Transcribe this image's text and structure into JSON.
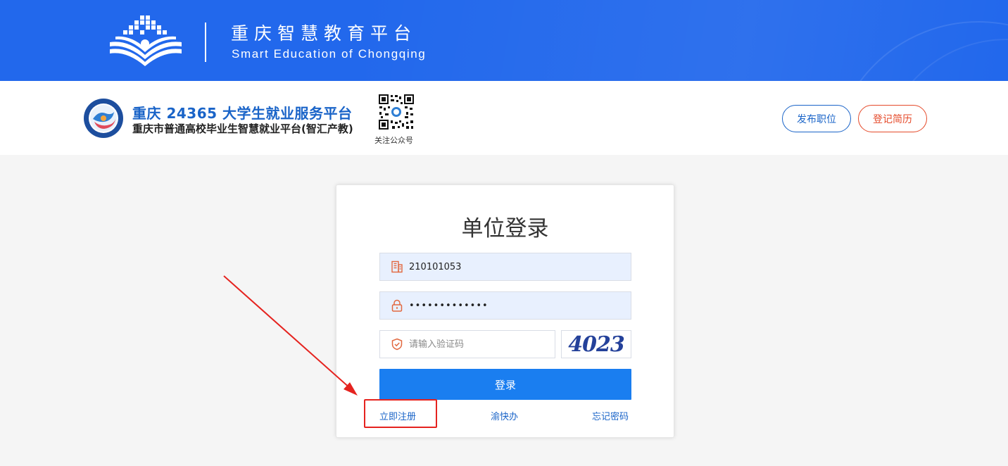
{
  "banner": {
    "title": "重庆智慧教育平台",
    "subtitle": "Smart Education of Chongqing"
  },
  "header": {
    "site_title": "重庆 24365 大学生就业服务平台",
    "site_subtitle": "重庆市普通高校毕业生智慧就业平台(智汇产教)",
    "qr_caption": "关注公众号",
    "buttons": {
      "post_job": "发布职位",
      "register_resume": "登记简历"
    }
  },
  "login": {
    "title": "单位登录",
    "account_value": "210101053",
    "password_mask": "•••••••••••••",
    "captcha_placeholder": "请输入验证码",
    "captcha_text": "4023",
    "submit_label": "登录",
    "links": {
      "register": "立即注册",
      "yukuaiban": "渝快办",
      "forgot": "忘记密码"
    }
  },
  "colors": {
    "banner_blue": "#2268ec",
    "link_blue": "#1a64c8",
    "primary_button": "#1a7ef0",
    "accent_red": "#e54a2a",
    "annotation_red": "#e5231f"
  },
  "icons": {
    "account": "building-icon",
    "password": "lock-icon",
    "captcha": "shield-check-icon"
  }
}
